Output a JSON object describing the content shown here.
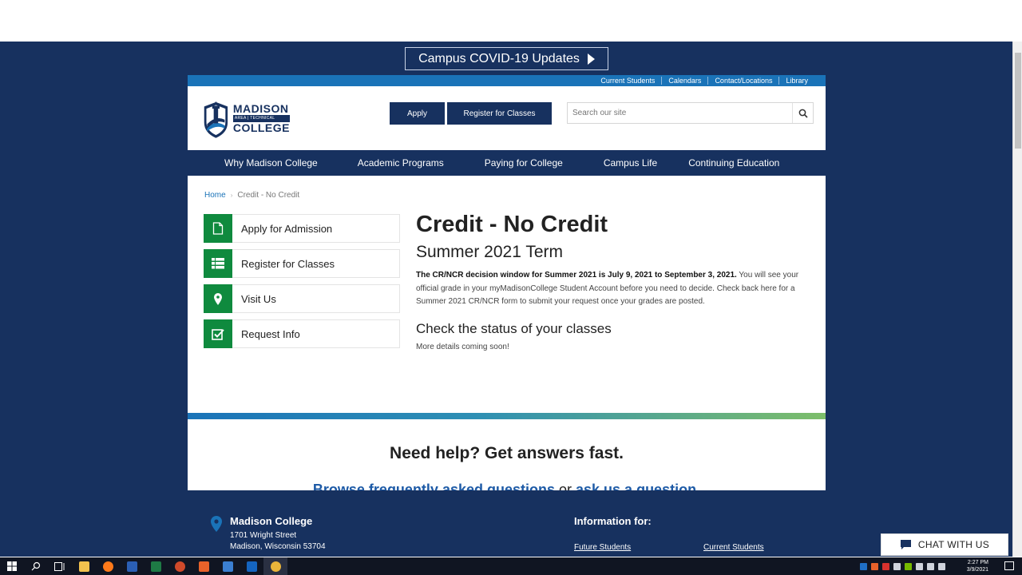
{
  "banner": {
    "covid_label": "Campus COVID-19 Updates"
  },
  "utility_links": [
    "Current Students",
    "Calendars",
    "Contact/Locations",
    "Library"
  ],
  "logo": {
    "line1": "MADISON",
    "line2": "AREA | TECHNICAL",
    "line3": "COLLEGE"
  },
  "header": {
    "apply_label": "Apply",
    "register_label": "Register for Classes",
    "search_placeholder": "Search our site"
  },
  "nav": [
    "Why Madison College",
    "Academic Programs",
    "Paying for College",
    "Campus Life",
    "Continuing Education"
  ],
  "breadcrumb": {
    "home": "Home",
    "current": "Credit - No Credit"
  },
  "sidebar": [
    {
      "label": "Apply for Admission",
      "icon": "document-icon"
    },
    {
      "label": "Register for Classes",
      "icon": "list-icon"
    },
    {
      "label": "Visit Us",
      "icon": "map-pin-icon"
    },
    {
      "label": "Request Info",
      "icon": "checkbox-icon"
    }
  ],
  "content": {
    "title": "Credit - No Credit",
    "subtitle": "Summer 2021 Term",
    "bold_text": "The CR/NCR decision window for Summer 2021 is July 9, 2021 to September 3, 2021.",
    "body_text": " You will see your official grade in your myMadisonCollege Student Account before you need to decide. Check back here for a Summer 2021 CR/NCR form to submit your request once your grades are posted.",
    "status_heading": "Check the status of your classes",
    "status_text": "More details coming soon!"
  },
  "help": {
    "title": "Need help? Get answers fast.",
    "link1": "Browse frequently asked questions",
    "middle": " or ",
    "link2": "ask us a question",
    "end": "."
  },
  "footer": {
    "name": "Madison College",
    "address1": "1701 Wright Street",
    "address2": "Madison, Wisconsin 53704",
    "info_heading": "Information for:",
    "link_future": "Future Students",
    "link_current": "Current Students"
  },
  "chat": {
    "label": "CHAT WITH US"
  },
  "taskbar": {
    "time": "2:27 PM",
    "date": "3/9/2021"
  },
  "colors": {
    "navy": "#17315f",
    "blue": "#1a73b8",
    "green": "#0f8a3e"
  }
}
